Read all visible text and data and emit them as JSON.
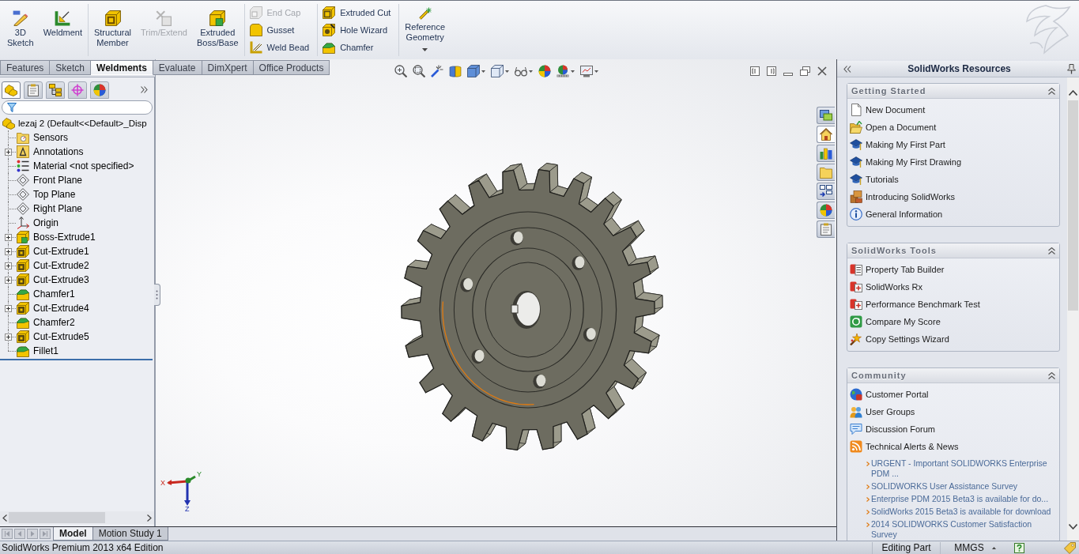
{
  "ribbon": {
    "groups": [
      {
        "kind": "large",
        "items": [
          {
            "label": "3D Sketch",
            "disabled": false,
            "dropdown": false
          },
          {
            "label": "Weldment",
            "disabled": false,
            "dropdown": false
          }
        ]
      },
      {
        "kind": "large",
        "items": [
          {
            "label": "Structural Member",
            "disabled": false,
            "dropdown": false
          },
          {
            "label": "Trim/Extend",
            "disabled": true,
            "dropdown": false
          },
          {
            "label": "Extruded Boss/Base",
            "disabled": false,
            "dropdown": false
          }
        ]
      },
      {
        "kind": "stack",
        "items": [
          {
            "label": "End Cap",
            "disabled": true
          },
          {
            "label": "Gusset",
            "disabled": false
          },
          {
            "label": "Weld Bead",
            "disabled": false
          }
        ]
      },
      {
        "kind": "stack",
        "items": [
          {
            "label": "Extruded Cut",
            "disabled": false
          },
          {
            "label": "Hole Wizard",
            "disabled": false
          },
          {
            "label": "Chamfer",
            "disabled": false
          }
        ]
      },
      {
        "kind": "large",
        "items": [
          {
            "label": "Reference Geometry",
            "disabled": false,
            "dropdown": true
          }
        ]
      }
    ]
  },
  "command_tabs": [
    {
      "label": "Features",
      "selected": false
    },
    {
      "label": "Sketch",
      "selected": false
    },
    {
      "label": "Weldments",
      "selected": true
    },
    {
      "label": "Evaluate",
      "selected": false
    },
    {
      "label": "DimXpert",
      "selected": false
    },
    {
      "label": "Office Products",
      "selected": false
    }
  ],
  "feature_manager": {
    "tabs": [
      {
        "kind": "feature-tree",
        "selected": true
      },
      {
        "kind": "property",
        "selected": false
      },
      {
        "kind": "configuration",
        "selected": false
      },
      {
        "kind": "dimxpert",
        "selected": false
      },
      {
        "kind": "display",
        "selected": false
      }
    ],
    "tree": {
      "label": "lezaj 2 (Default<<Default>_Disp",
      "kind": "part",
      "children": [
        {
          "label": "Sensors",
          "kind": "sensors",
          "expandable": false
        },
        {
          "label": "Annotations",
          "kind": "annotations",
          "expandable": true
        },
        {
          "label": "Material <not specified>",
          "kind": "material",
          "expandable": false
        },
        {
          "label": "Front Plane",
          "kind": "plane",
          "expandable": false
        },
        {
          "label": "Top Plane",
          "kind": "plane",
          "expandable": false
        },
        {
          "label": "Right Plane",
          "kind": "plane",
          "expandable": false
        },
        {
          "label": "Origin",
          "kind": "origin",
          "expandable": false
        },
        {
          "label": "Boss-Extrude1",
          "kind": "boss",
          "expandable": true
        },
        {
          "label": "Cut-Extrude1",
          "kind": "cut",
          "expandable": true
        },
        {
          "label": "Cut-Extrude2",
          "kind": "cut",
          "expandable": true
        },
        {
          "label": "Cut-Extrude3",
          "kind": "cut",
          "expandable": true
        },
        {
          "label": "Chamfer1",
          "kind": "chamfer",
          "expandable": false
        },
        {
          "label": "Cut-Extrude4",
          "kind": "cut",
          "expandable": true
        },
        {
          "label": "Chamfer2",
          "kind": "chamfer",
          "expandable": false
        },
        {
          "label": "Cut-Extrude5",
          "kind": "cut",
          "expandable": true
        },
        {
          "label": "Fillet1",
          "kind": "fillet",
          "expandable": false
        }
      ]
    }
  },
  "graphics": {
    "heads_up_toolbar": [
      {
        "dropdown": false
      },
      {
        "dropdown": false
      },
      {
        "dropdown": false
      },
      {
        "dropdown": false
      },
      {
        "dropdown": true
      },
      {
        "dropdown": true
      },
      {
        "dropdown": true
      },
      {
        "dropdown": false
      },
      {
        "dropdown": true
      },
      {
        "dropdown": true
      }
    ],
    "task_pane_tabs": [
      {
        "selected": false
      },
      {
        "selected": true
      },
      {
        "selected": false
      },
      {
        "selected": false
      },
      {
        "selected": false
      },
      {
        "selected": false
      },
      {
        "selected": false
      }
    ],
    "triad": {
      "x": "X",
      "y": "Y",
      "z": "Z"
    }
  },
  "model_tabs": [
    {
      "label": "Model",
      "selected": true
    },
    {
      "label": "Motion Study 1",
      "selected": false
    }
  ],
  "resources": {
    "title": "SolidWorks Resources",
    "groups": [
      {
        "title": "Getting Started",
        "expanded": true,
        "items": [
          {
            "label": "New Document"
          },
          {
            "label": "Open a Document"
          },
          {
            "label": "Making My First Part"
          },
          {
            "label": "Making My First Drawing"
          },
          {
            "label": "Tutorials"
          },
          {
            "label": "Introducing SolidWorks"
          },
          {
            "label": "General Information"
          }
        ]
      },
      {
        "title": "SolidWorks Tools",
        "expanded": true,
        "items": [
          {
            "label": "Property Tab Builder"
          },
          {
            "label": "SolidWorks Rx"
          },
          {
            "label": "Performance Benchmark Test"
          },
          {
            "label": "Compare My Score"
          },
          {
            "label": "Copy Settings Wizard"
          }
        ]
      },
      {
        "title": "Community",
        "expanded": true,
        "items": [
          {
            "label": "Customer Portal"
          },
          {
            "label": "User Groups"
          },
          {
            "label": "Discussion Forum"
          },
          {
            "label": "Technical Alerts & News"
          }
        ],
        "news": [
          "URGENT - Important SOLIDWORKS Enterprise PDM ...",
          "SOLIDWORKS User Assistance Survey",
          "Enterprise PDM 2015 Beta3 is available for do...",
          "SolidWorks 2015 Beta3 is available for download",
          "2014 SOLIDWORKS Customer Satisfaction Survey"
        ]
      }
    ]
  },
  "status_bar": {
    "product": "SolidWorks Premium 2013 x64 Edition",
    "mode": "Editing Part",
    "units": "MMGS"
  }
}
